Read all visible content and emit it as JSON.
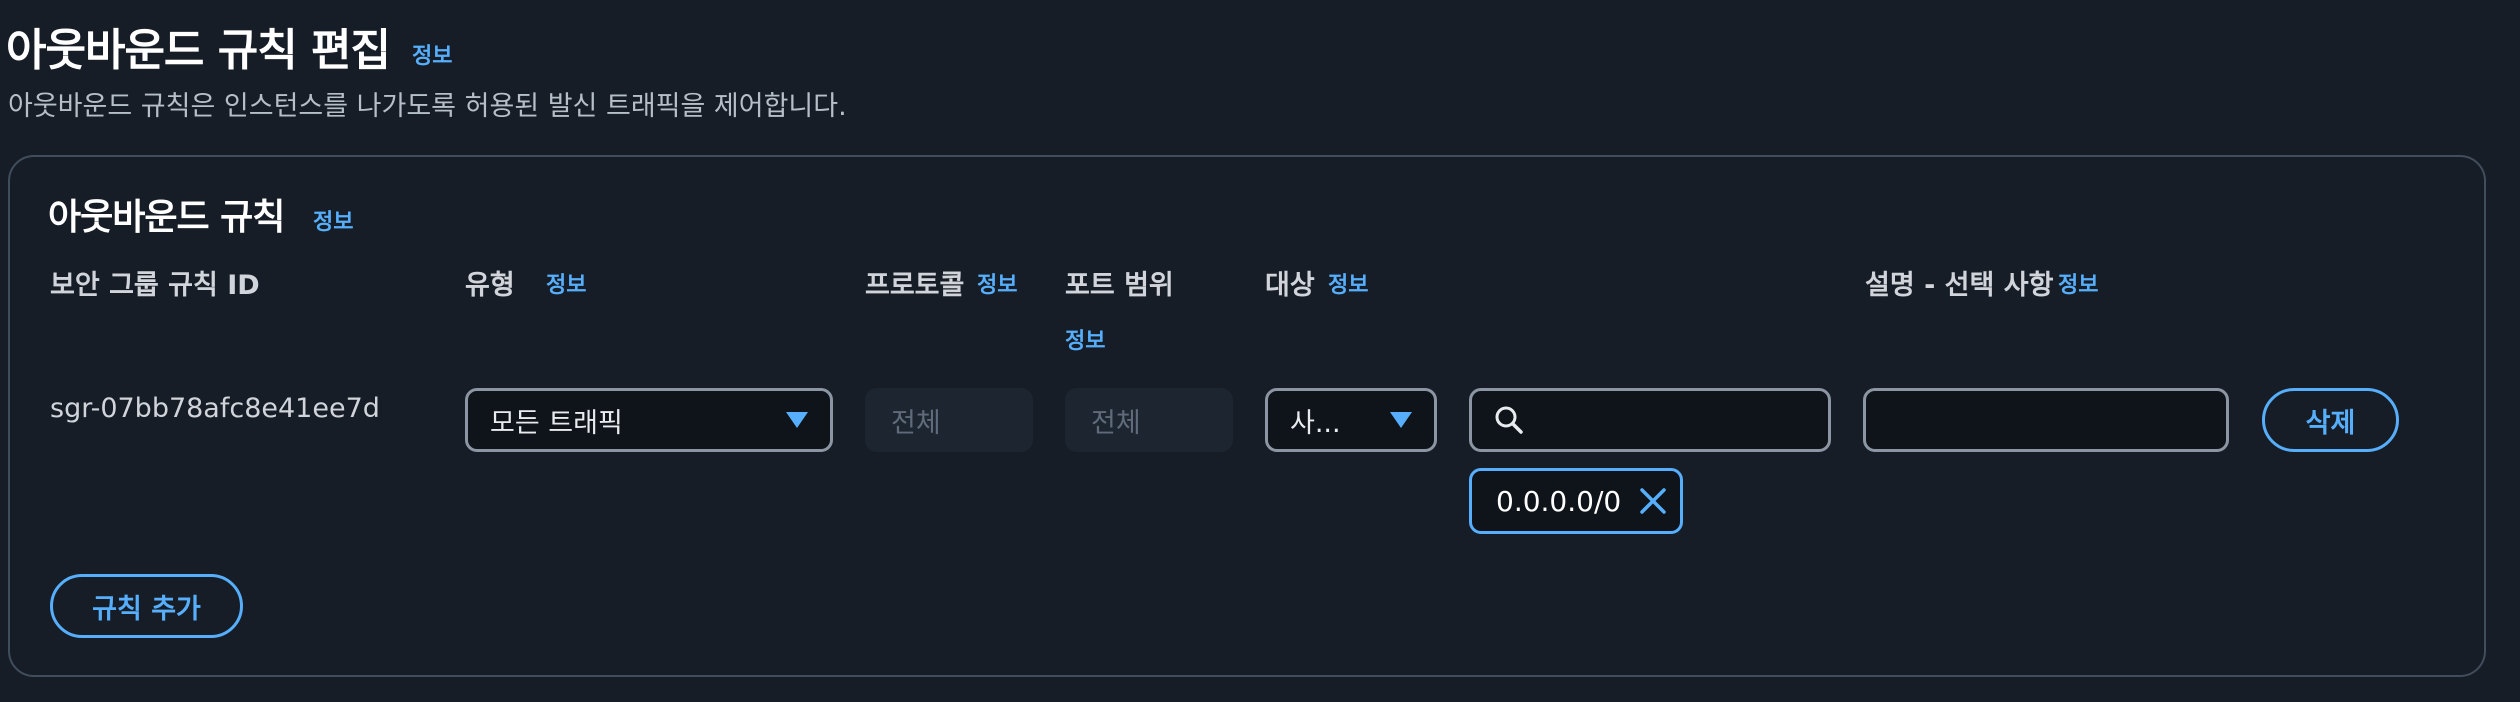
{
  "page": {
    "title": "아웃바운드 규칙 편집",
    "title_info": "정보",
    "description": "아웃바운드 규칙은 인스턴스를 나가도록 허용된 발신 트래픽을 제어합니다."
  },
  "section": {
    "title": "아웃바운드 규칙",
    "info": "정보"
  },
  "columns": {
    "rule_id": "보안 그룹 규칙 ID",
    "type": "유형",
    "type_info": "정보",
    "protocol": "프로토콜",
    "protocol_info": "정보",
    "port_range": "포트 범위",
    "port_range_info": "정보",
    "destination": "대상",
    "destination_info": "정보",
    "description": "설명 - 선택 사항",
    "description_info": "정보"
  },
  "rule": {
    "id": "sgr-07bb78afc8e41ee7d",
    "type_value": "모든 트래픽",
    "protocol_value": "전체",
    "port_value": "전체",
    "destination_type": "사...",
    "destination_search": "",
    "destination_token": "0.0.0.0/0",
    "description_value": "",
    "delete_label": "삭제"
  },
  "add_rule_label": "규칙 추가",
  "colors": {
    "background": "#161d26",
    "accent": "#56aefc",
    "border": "#8c95a3"
  }
}
